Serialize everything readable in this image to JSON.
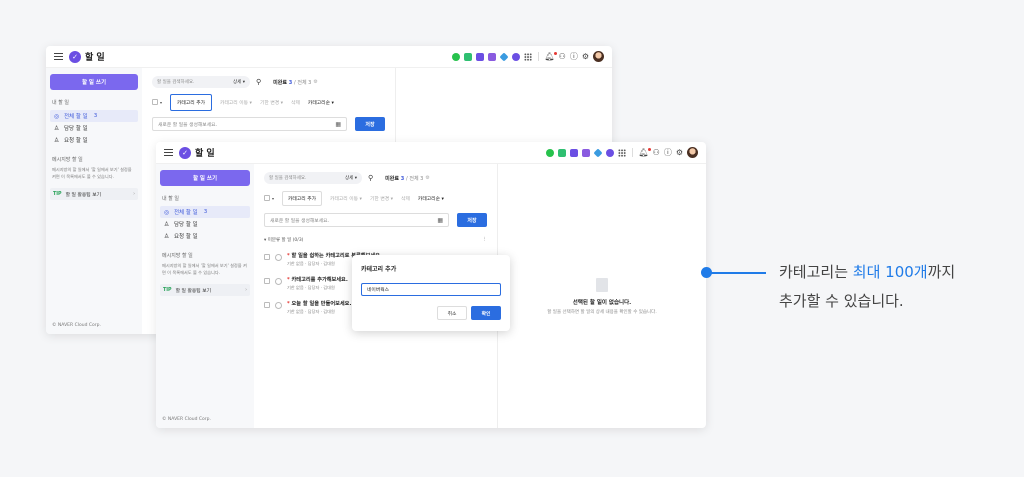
{
  "app": {
    "title": "할 일",
    "logo_glyph": "✓"
  },
  "sidebar": {
    "new_button": "할 일 쓰기",
    "section_title": "내 할 일",
    "items": [
      {
        "label": "전체 할 일",
        "count": "3",
        "icon": "check-circle-icon",
        "active": true
      },
      {
        "label": "담당 할 일",
        "icon": "person-icon"
      },
      {
        "label": "요청 할 일",
        "icon": "request-person-icon"
      }
    ],
    "message_title": "메시지방 할 일",
    "message_text": "메시지방의 할 일에서 '할 일에서 보기' 설정을 켜면 이 목록에서도 볼 수 있습니다.",
    "tip_badge": "TIP",
    "tip_label": "할 일 활용팁 보기",
    "tip_chevron": "›",
    "copyright": "© NAVER Cloud Corp."
  },
  "search": {
    "placeholder": "할 일을 검색하세요.",
    "detail": "상세 ▾"
  },
  "counts": {
    "label": "미완료",
    "incomplete": "3",
    "sep": "/",
    "total_label": "전체 3"
  },
  "toolbar": {
    "add_category": "카테고리 추가",
    "category_move": "카테고리 이동 ▾",
    "due_change": "기한 변경 ▾",
    "delete": "삭제",
    "sort": "카테고리순 ▾"
  },
  "add_task": {
    "placeholder": "새로운 할 일을 생성해보세요.",
    "save": "저장"
  },
  "group": {
    "title": "▾ 미분류 할 일 (0/3)",
    "more": "⋮"
  },
  "tasks": [
    {
      "star": "*",
      "title": "할 일을 쉽하는 카테고리로 분류해보세요.",
      "meta": "기한 없음 · 담당자 · 김대원"
    },
    {
      "star": "*",
      "title": "카테고리를 추가해보세요.",
      "meta": "기한 없음 · 담당자 · 김대원"
    },
    {
      "star": "*",
      "title": "오늘 할 일을 만들어보세요.",
      "meta": "기한 없음 · 담당자 · 김대원"
    }
  ],
  "detail": {
    "title": "선택된 할 일이 없습니다.",
    "subtitle": "할 일을 선택하면 할 일의 상세 내용을 확인할 수 있습니다."
  },
  "dialog": {
    "title": "카테고리 추가",
    "input_value": "네이버웍스",
    "cancel": "취소",
    "confirm": "확인"
  },
  "callout": {
    "line1_prefix": "카테고리는 ",
    "line1_highlight": "최대 100개",
    "line1_suffix": "까지",
    "line2": "추가할 수 있습니다."
  },
  "colors": {
    "accent": "#7b68ee",
    "primary": "#2b6de0",
    "callout": "#1f7be8"
  },
  "top_icons": [
    "chat-icon",
    "mail-icon",
    "calendar-icon",
    "contacts-icon",
    "drive-icon",
    "todo-icon",
    "apps-grid-icon",
    "bell-icon",
    "org-icon",
    "help-icon",
    "settings-icon",
    "avatar"
  ]
}
